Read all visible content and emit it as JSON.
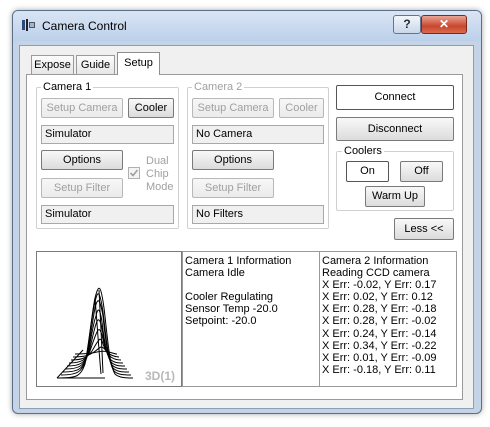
{
  "window": {
    "title": "Camera Control",
    "help_label": "?",
    "close_label": "✕"
  },
  "tabs": [
    "Expose",
    "Guide",
    "Setup"
  ],
  "camera1": {
    "group_label": "Camera 1",
    "setup_camera": "Setup Camera",
    "cooler": "Cooler",
    "name": "Simulator",
    "options": "Options",
    "dual_chip_mode": "Dual Chip Mode",
    "dual_chip_line1": "Dual",
    "dual_chip_line2": "Chip",
    "dual_chip_line3": "Mode",
    "setup_filter": "Setup Filter",
    "filter": "Simulator"
  },
  "camera2": {
    "group_label": "Camera 2",
    "setup_camera": "Setup Camera",
    "cooler": "Cooler",
    "name": "No Camera",
    "options": "Options",
    "setup_filter": "Setup Filter",
    "filter": "No Filters"
  },
  "connect": "Connect",
  "disconnect": "Disconnect",
  "coolers": {
    "label": "Coolers",
    "on": "On",
    "off": "Off",
    "warm_up": "Warm Up"
  },
  "less": "Less <<",
  "graph": {
    "label": "3D(1)"
  },
  "camera1_info": [
    "Camera 1 Information",
    "Camera Idle",
    "",
    "Cooler Regulating",
    "Sensor Temp -20.0",
    "Setpoint: -20.0"
  ],
  "camera2_info": [
    "Camera 2 Information",
    "Reading CCD camera",
    "X Err: -0.02, Y Err: 0.17",
    "X Err: 0.02, Y Err: 0.12",
    "X Err: 0.28, Y Err: -0.18",
    "X Err: 0.28, Y Err: -0.02",
    "X Err: 0.24, Y Err: -0.14",
    "X Err: 0.34, Y Err: -0.22",
    "X Err: 0.01, Y Err: -0.09",
    "X Err: -0.18, Y Err: 0.11"
  ],
  "colors": {
    "title_bar": "#bcd0ea",
    "close_button": "#c9462c",
    "frame": "#c4d3e6"
  }
}
